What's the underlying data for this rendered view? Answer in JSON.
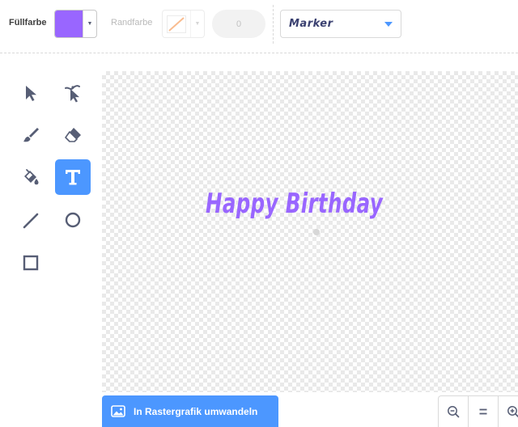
{
  "toolbar": {
    "fill_label": "Füllfarbe",
    "fill_color": "#9966ff",
    "stroke_label": "Randfarbe",
    "stroke_width": "0",
    "font_value": "Marker"
  },
  "tools": [
    {
      "name": "select-tool",
      "icon": "arrow-pointer-icon"
    },
    {
      "name": "reshape-tool",
      "icon": "reshape-pointer-icon"
    },
    {
      "name": "brush-tool",
      "icon": "brush-icon"
    },
    {
      "name": "eraser-tool",
      "icon": "eraser-icon"
    },
    {
      "name": "fill-tool",
      "icon": "paint-bucket-icon"
    },
    {
      "name": "text-tool",
      "icon": "text-icon",
      "active": true
    },
    {
      "name": "line-tool",
      "icon": "line-icon"
    },
    {
      "name": "circle-tool",
      "icon": "circle-icon"
    },
    {
      "name": "rectangle-tool",
      "icon": "rectangle-icon"
    }
  ],
  "canvas": {
    "text": "Happy Birthday",
    "text_color": "#9966ff"
  },
  "bottom": {
    "convert_label": "In Rastergrafik umwandeln",
    "zoom_out_icon": "zoom-out-icon",
    "zoom_reset_icon": "equals-icon",
    "zoom_in_icon": "zoom-in-icon"
  },
  "colors": {
    "accent": "#4c97ff",
    "fill": "#9966ff"
  }
}
